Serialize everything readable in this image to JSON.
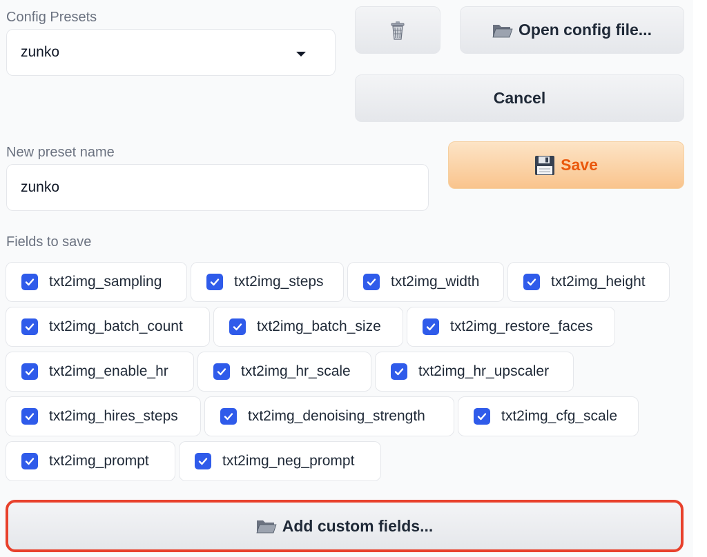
{
  "config_presets": {
    "label": "Config Presets",
    "selected": "zunko"
  },
  "buttons": {
    "open_config": "Open config file...",
    "cancel": "Cancel",
    "save": "Save",
    "add_custom_fields": "Add custom fields..."
  },
  "new_preset": {
    "label": "New preset name",
    "value": "zunko"
  },
  "fields_to_save": {
    "label": "Fields to save",
    "rows": [
      [
        {
          "label": "txt2img_sampling",
          "checked": true
        },
        {
          "label": "txt2img_steps",
          "checked": true
        },
        {
          "label": "txt2img_width",
          "checked": true
        },
        {
          "label": "txt2img_height",
          "checked": true
        }
      ],
      [
        {
          "label": "txt2img_batch_count",
          "checked": true
        },
        {
          "label": "txt2img_batch_size",
          "checked": true
        },
        {
          "label": "txt2img_restore_faces",
          "checked": true
        }
      ],
      [
        {
          "label": "txt2img_enable_hr",
          "checked": true
        },
        {
          "label": "txt2img_hr_scale",
          "checked": true
        },
        {
          "label": "txt2img_hr_upscaler",
          "checked": true
        }
      ],
      [
        {
          "label": "txt2img_hires_steps",
          "checked": true
        },
        {
          "label": "txt2img_denoising_strength",
          "checked": true
        },
        {
          "label": "txt2img_cfg_scale",
          "checked": true
        }
      ],
      [
        {
          "label": "txt2img_prompt",
          "checked": true
        },
        {
          "label": "txt2img_neg_prompt",
          "checked": true
        }
      ]
    ]
  },
  "icons": {
    "delete": "trash-icon",
    "open": "folder-icon",
    "save": "floppy-disk-icon"
  },
  "colors": {
    "checkbox": "#2f5bea",
    "save_text": "#ea580c",
    "highlight_border": "#e8412c"
  }
}
